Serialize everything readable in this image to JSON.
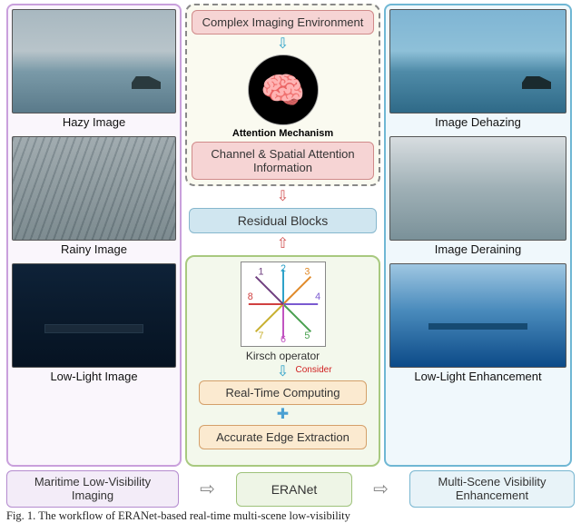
{
  "left": {
    "items": [
      {
        "caption": "Hazy Image"
      },
      {
        "caption": "Rainy Image"
      },
      {
        "caption": "Low-Light Image"
      }
    ]
  },
  "right": {
    "items": [
      {
        "caption": "Image Dehazing"
      },
      {
        "caption": "Image Deraining"
      },
      {
        "caption": "Low-Light Enhancement"
      }
    ]
  },
  "mid": {
    "complex_env": "Complex Imaging Environment",
    "attention_label": "Attention Mechanism",
    "csai": "Channel & Spatial Attention Information",
    "residual": "Residual Blocks",
    "kirsch_caption": "Kirsch operator",
    "consider": "Consider",
    "realtime": "Real-Time Computing",
    "edge": "Accurate Edge Extraction"
  },
  "kirsch_nums": [
    "1",
    "2",
    "3",
    "4",
    "5",
    "6",
    "7",
    "8"
  ],
  "arrows": {
    "down_cyan": "⇩",
    "down_red": "⇩",
    "up_red": "⇧",
    "plus": "✚",
    "chain": "⇨"
  },
  "bottom": {
    "left": "Maritime Low-Visibility Imaging",
    "mid": "ERANet",
    "right": "Multi-Scene Visibility Enhancement"
  },
  "figcap": "Fig. 1.  The workflow of ERANet-based real-time multi-scene low-visibility"
}
